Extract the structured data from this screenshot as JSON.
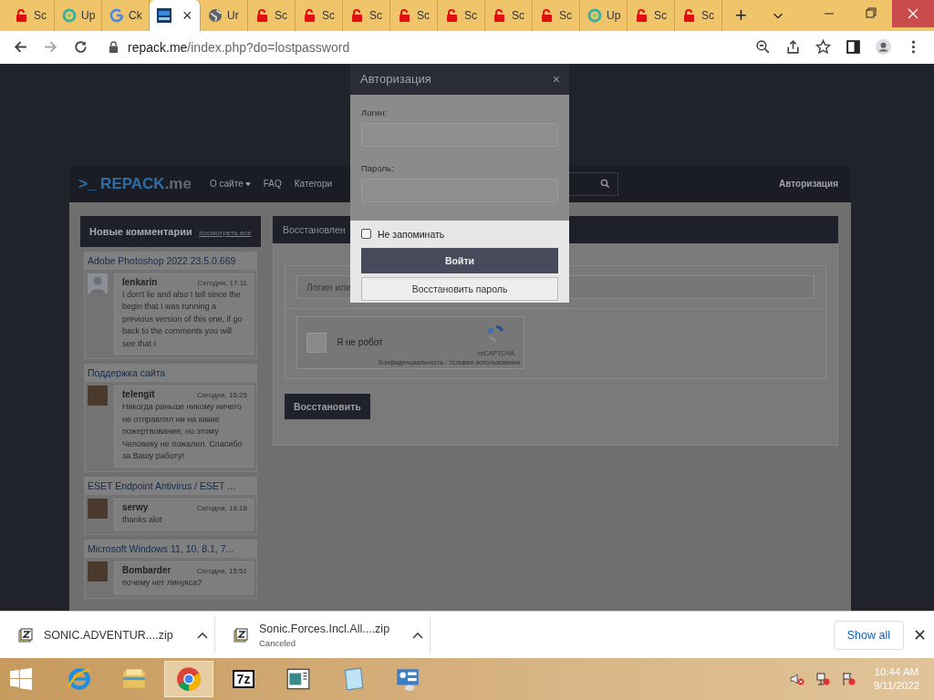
{
  "browser": {
    "tabs": [
      {
        "title": "Sc",
        "kind": "lock",
        "selected": false
      },
      {
        "title": "Up",
        "kind": "recycle",
        "selected": false
      },
      {
        "title": "Ck",
        "kind": "google",
        "selected": false
      },
      {
        "kind": "repack",
        "selected": true,
        "close": "×"
      },
      {
        "title": "Ur",
        "kind": "globe",
        "selected": false
      },
      {
        "title": "Sc",
        "kind": "lock",
        "selected": false
      },
      {
        "title": "Sc",
        "kind": "lock",
        "selected": false
      },
      {
        "title": "Sc",
        "kind": "lock",
        "selected": false
      },
      {
        "title": "Sc",
        "kind": "lock",
        "selected": false
      },
      {
        "title": "Sc",
        "kind": "lock",
        "selected": false
      },
      {
        "title": "Sc",
        "kind": "lock",
        "selected": false
      },
      {
        "title": "Sc",
        "kind": "lock",
        "selected": false
      },
      {
        "title": "Up",
        "kind": "recycle",
        "selected": false
      },
      {
        "title": "Sc",
        "kind": "lock",
        "selected": false
      },
      {
        "title": "Sc",
        "kind": "lock",
        "selected": false
      }
    ],
    "new_tab": "+",
    "url_host": "repack.me",
    "url_path": "/index.php?do=lostpassword"
  },
  "site": {
    "logo_prompt": ">_",
    "logo_name": "REPACK",
    "logo_tld": ".me",
    "nav": [
      {
        "label": "О сайте",
        "kind": "dropdown"
      },
      {
        "label": "FAQ",
        "kind": "link"
      },
      {
        "label": "Категори",
        "kind": "link"
      }
    ],
    "auth_link": "Авторизация",
    "sidebar": {
      "title": "Новые комментарии",
      "link": "посмотреть все",
      "comments": [
        {
          "topic": "Adobe Photoshop 2022 23.5.0.669",
          "kind": "silhouette",
          "user": "lenkarin",
          "time": "Сегодня, 17:11",
          "text": "I don't lie and also I tell since the begin that I was running a previous version of this one, if go back to the comments you will see that I"
        },
        {
          "topic": "Поддержка сайта",
          "kind": "photo",
          "user": "telengit",
          "time": "Сегодня, 16:25",
          "text": "Никогда раньше никому ничего не отправлял ни на какие пожертвования, но этому Человеку не пожалел. Спасибо за Вашу работу!"
        },
        {
          "topic": "ESET Endpoint Antivirus / ESET ...",
          "kind": "photo",
          "user": "serwy",
          "time": "Сегодня, 16:18",
          "text": "thanks alot"
        },
        {
          "topic": "Microsoft Windows 11, 10, 8.1, 7...",
          "kind": "photo",
          "user": "Bombarder",
          "time": "Сегодня, 15:51",
          "text": "почему нет линукса?"
        }
      ]
    },
    "main": {
      "heading": "Восстановлен",
      "login_placeholder": "Логин или",
      "captcha": {
        "label": "Я не робот",
        "checked": false,
        "brand": "reCAPTCHA",
        "terms": "Конфиденциальность - Условия использования"
      },
      "submit": "Восстановить"
    }
  },
  "modal": {
    "title": "Авторизация",
    "close": "×",
    "login_label": "Логин:",
    "password_label": "Пароль:",
    "remember": {
      "label": "Не запоминать",
      "checked": false
    },
    "login_button": "Войти",
    "restore_button": "Восстановить пароль"
  },
  "downloads": {
    "items": [
      {
        "name": "SONIC.ADVENTUR....zip"
      },
      {
        "name": "Sonic.Forces.Incl.All....zip",
        "status": "Canceled"
      }
    ],
    "show_all": "Show all"
  },
  "taskbar": {
    "apps": [
      {
        "kind": "ie",
        "selected": false
      },
      {
        "kind": "folder",
        "selected": false
      },
      {
        "kind": "chrome",
        "selected": true
      },
      {
        "kind": "sevenzip",
        "label": "7z",
        "selected": false
      },
      {
        "kind": "window",
        "selected": false
      },
      {
        "kind": "notepad",
        "selected": false
      },
      {
        "kind": "panel",
        "selected": false
      }
    ],
    "time": "10:44 AM",
    "date": "9/11/2022"
  }
}
